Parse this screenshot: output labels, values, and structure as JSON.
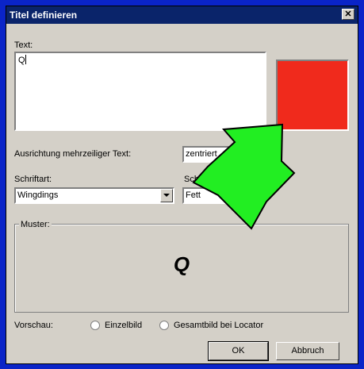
{
  "window": {
    "title": "Titel definieren",
    "close_glyph": "✕"
  },
  "text_section": {
    "label": "Text:",
    "value": "Q"
  },
  "color_swatch": {
    "color": "#f02a1c"
  },
  "alignment": {
    "label": "Ausrichtung mehrzeiliger Text:",
    "value": "zentriert"
  },
  "font": {
    "label": "Schriftart:",
    "value": "Wingdings"
  },
  "style": {
    "label": "Schrifts",
    "value": "Fett"
  },
  "muster": {
    "label": "Muster:",
    "sample": "Q"
  },
  "preview": {
    "label": "Vorschau:",
    "option1": "Einzelbild",
    "option2": "Gesamtbild bei Locator"
  },
  "buttons": {
    "ok": "OK",
    "cancel": "Abbruch"
  },
  "overlay": {
    "arrow_color": "#22ee22"
  }
}
